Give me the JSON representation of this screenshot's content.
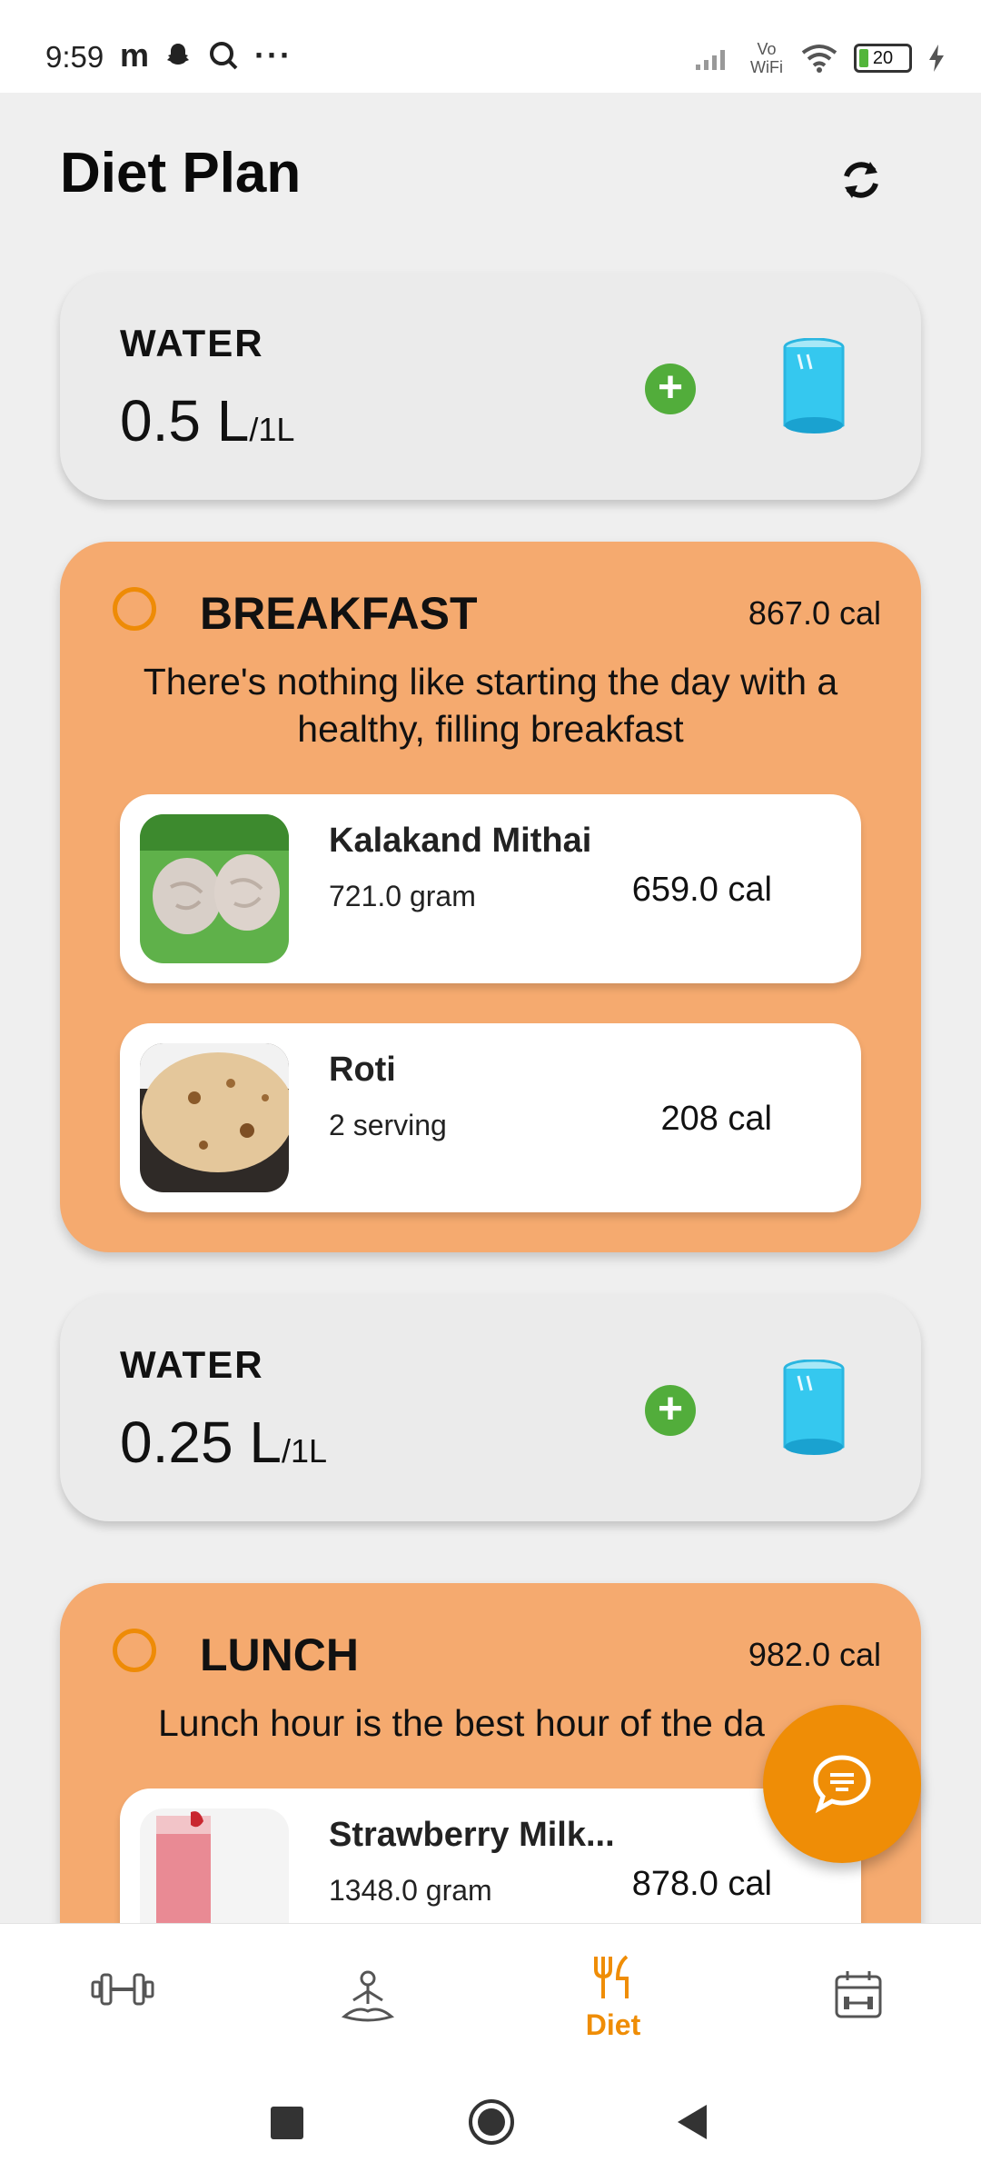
{
  "status_bar": {
    "time": "9:59",
    "left_icons": [
      "m-icon",
      "snapchat-icon",
      "search-icon",
      "more-icon"
    ],
    "right_icons": [
      "signal-icon",
      "vowifi-icon",
      "wifi-icon",
      "battery-icon",
      "charging-icon"
    ],
    "vowifi_text": "Vo WiFi",
    "battery_level": "20"
  },
  "header": {
    "title": "Diet Plan"
  },
  "water_cards": [
    {
      "label": "WATER",
      "amount": "0.5 L",
      "goal": "/1L"
    },
    {
      "label": "WATER",
      "amount": "0.25 L",
      "goal": "/1L"
    }
  ],
  "meals": [
    {
      "name": "BREAKFAST",
      "calories": "867.0 cal",
      "description": "There's nothing like starting the day with a healthy, filling breakfast",
      "items": [
        {
          "name": "Kalakand Mithai",
          "quantity": "721.0 gram",
          "calories": "659.0 cal"
        },
        {
          "name": "Roti",
          "quantity": "2 serving",
          "calories": "208 cal"
        }
      ]
    },
    {
      "name": "LUNCH",
      "calories": "982.0 cal",
      "description": "Lunch hour is the best hour of the da",
      "items": [
        {
          "name": "Strawberry Milk...",
          "quantity": "1348.0 gram",
          "calories": "878.0 cal"
        }
      ]
    }
  ],
  "bottom_nav": {
    "items": [
      {
        "icon": "dumbbell-icon",
        "label": ""
      },
      {
        "icon": "meditation-icon",
        "label": ""
      },
      {
        "icon": "fork-knife-icon",
        "label": "Diet",
        "active": true
      },
      {
        "icon": "calendar-workout-icon",
        "label": ""
      }
    ]
  },
  "colors": {
    "accent": "#ef8d06",
    "meal_card": "#f5aa6f",
    "add_green": "#52ad3b",
    "water_blue": "#35c8ef"
  }
}
